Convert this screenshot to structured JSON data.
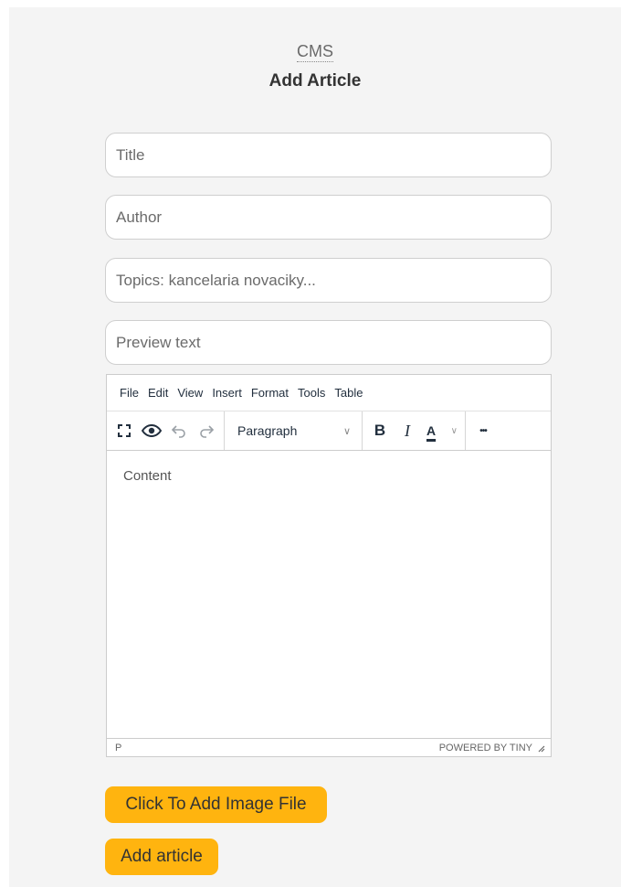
{
  "header": {
    "brand": "CMS",
    "title": "Add Article"
  },
  "form": {
    "title_placeholder": "Title",
    "author_placeholder": "Author",
    "topics_placeholder": "Topics: kancelaria novaciky...",
    "preview_placeholder": "Preview text"
  },
  "editor": {
    "menu": [
      "File",
      "Edit",
      "View",
      "Insert",
      "Format",
      "Tools",
      "Table"
    ],
    "block_format": "Paragraph",
    "bold_label": "B",
    "italic_label": "I",
    "color_label": "A",
    "more_label": "•••",
    "content_placeholder": "Content",
    "status_path": "P",
    "powered_by": "POWERED BY TINY"
  },
  "buttons": {
    "add_image": "Click To Add Image File",
    "add_article": "Add article"
  },
  "colors": {
    "button_accent": "#ffb40f",
    "page_background": "#f4f4f4"
  }
}
